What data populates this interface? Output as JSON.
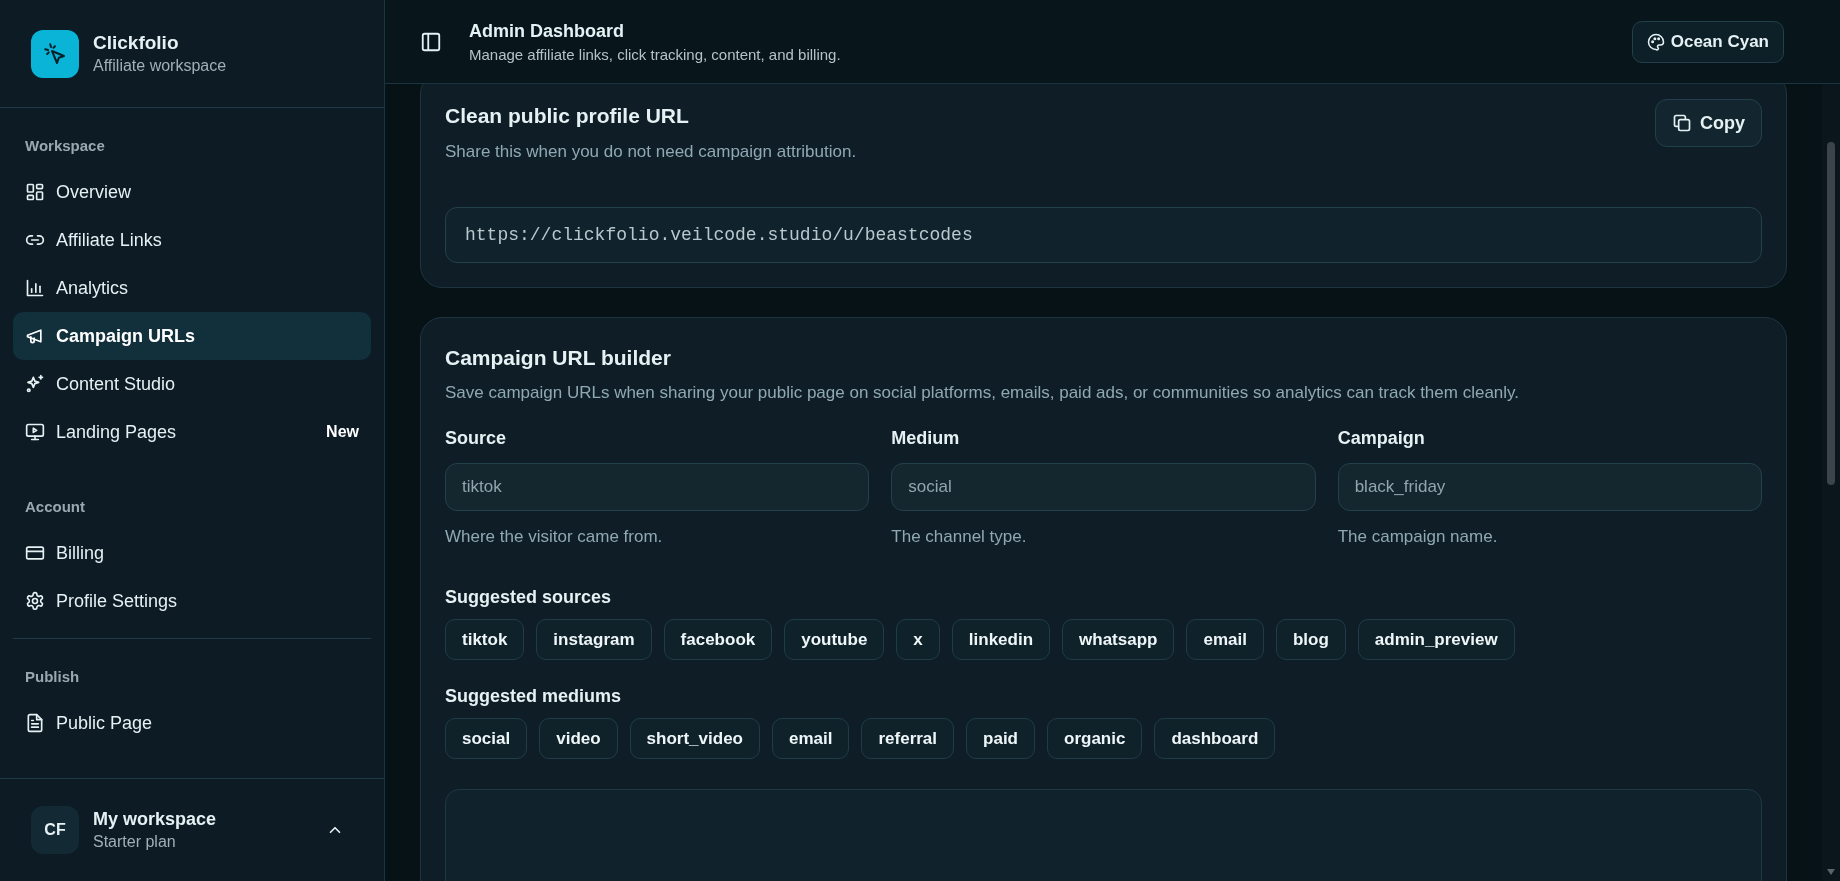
{
  "brand": {
    "name": "Clickfolio",
    "subtitle": "Affiliate workspace"
  },
  "sidebar": {
    "sections": [
      {
        "title": "Workspace",
        "items": [
          {
            "label": "Overview",
            "selected": false
          },
          {
            "label": "Affiliate Links",
            "selected": false
          },
          {
            "label": "Analytics",
            "selected": false
          },
          {
            "label": "Campaign URLs",
            "selected": true
          },
          {
            "label": "Content Studio",
            "selected": false
          },
          {
            "label": "Landing Pages",
            "selected": false,
            "badge": "New"
          }
        ]
      },
      {
        "title": "Account",
        "items": [
          {
            "label": "Billing",
            "selected": false
          },
          {
            "label": "Profile Settings",
            "selected": false
          }
        ]
      },
      {
        "title": "Publish",
        "items": [
          {
            "label": "Public Page",
            "selected": false
          }
        ]
      }
    ]
  },
  "workspace": {
    "initials": "CF",
    "name": "My workspace",
    "plan": "Starter plan"
  },
  "header": {
    "title": "Admin Dashboard",
    "subtitle": "Manage affiliate links, click tracking, content, and billing.",
    "theme_button": "Ocean Cyan"
  },
  "profile_card": {
    "title": "Clean public profile URL",
    "description": "Share this when you do not need campaign attribution.",
    "copy_button": "Copy",
    "url": "https://clickfolio.veilcode.studio/u/beastcodes"
  },
  "builder": {
    "title": "Campaign URL builder",
    "description": "Save campaign URLs when sharing your public page on social platforms, emails, paid ads, or communities so analytics can track them cleanly.",
    "fields": [
      {
        "label": "Source",
        "placeholder": "tiktok",
        "hint": "Where the visitor came from."
      },
      {
        "label": "Medium",
        "placeholder": "social",
        "hint": "The channel type."
      },
      {
        "label": "Campaign",
        "placeholder": "black_friday",
        "hint": "The campaign name."
      }
    ],
    "suggestion_groups": [
      {
        "title": "Suggested sources",
        "chips": [
          "tiktok",
          "instagram",
          "facebook",
          "youtube",
          "x",
          "linkedin",
          "whatsapp",
          "email",
          "blog",
          "admin_preview"
        ]
      },
      {
        "title": "Suggested mediums",
        "chips": [
          "social",
          "video",
          "short_video",
          "email",
          "referral",
          "paid",
          "organic",
          "dashboard"
        ]
      }
    ]
  }
}
